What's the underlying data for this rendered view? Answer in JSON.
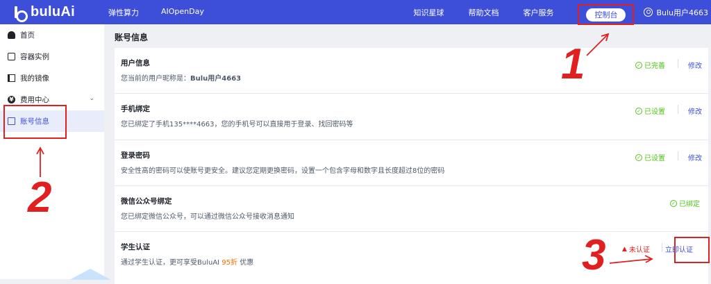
{
  "header": {
    "logo_text": "buluAi",
    "nav_left": [
      "弹性算力",
      "AIOpenDay"
    ],
    "nav_right": [
      "知识星球",
      "帮助文档",
      "客户服务"
    ],
    "console_label": "控制台",
    "user_name": "Bulu用户4663"
  },
  "sidebar": {
    "items": [
      {
        "label": "首页",
        "icon": "home-icon"
      },
      {
        "label": "容器实例",
        "icon": "container-icon"
      },
      {
        "label": "我的镜像",
        "icon": "image-icon"
      },
      {
        "label": "费用中心",
        "icon": "yen-icon",
        "chevron": "chevron-down-icon"
      },
      {
        "label": "账号信息",
        "icon": "document-icon",
        "active": true
      }
    ]
  },
  "main": {
    "page_title": "账号信息",
    "rows": [
      {
        "title": "用户信息",
        "desc_prefix": "您当前的用户昵称是：",
        "desc_value": "Bulu用户4663",
        "status": "已完善",
        "action": "修改"
      },
      {
        "title": "手机绑定",
        "desc": "您已绑定了手机135****4663，您的手机号可以直接用于登录、找回密码等",
        "status": "已设置",
        "action": "修改"
      },
      {
        "title": "登录密码",
        "desc": "安全性高的密码可以使账号更安全。建议您定期更换密码，设置一个包含字母和数字且长度超过8位的密码",
        "status": "已设置",
        "action": "修改"
      },
      {
        "title": "微信公众号绑定",
        "desc": "您已绑定微信公众号，可以通过微信公众号接收消息通知",
        "status": "已绑定"
      },
      {
        "title": "学生认证",
        "desc_prefix": "通过学生认证，更可享受BuluAI ",
        "desc_highlight": "95折",
        "desc_suffix": " 优惠",
        "status": "未认证",
        "action": "立即认证"
      }
    ]
  },
  "annotations": {
    "one": "1",
    "two": "2",
    "three": "3"
  },
  "colors": {
    "brand": "#3d4fd8",
    "annotation": "#e02020",
    "success": "#52c41a",
    "highlight": "#ff6a00"
  }
}
